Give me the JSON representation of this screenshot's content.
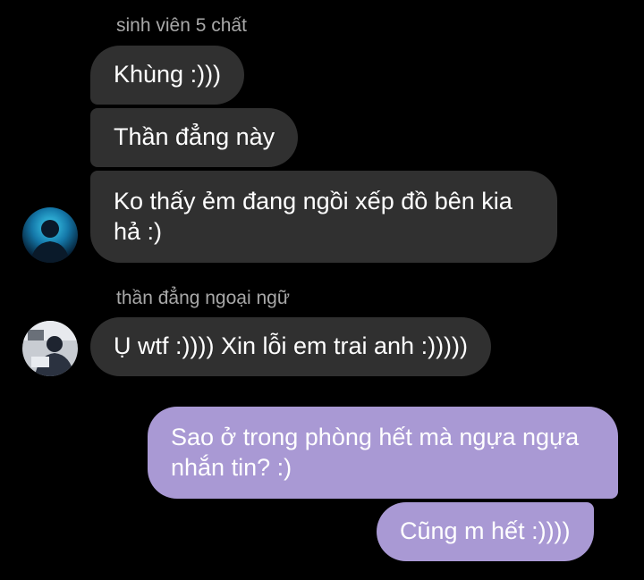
{
  "groups": [
    {
      "sender": "sinh viên 5 chất",
      "messages": [
        "Khùng :)))",
        "Thần đẳng này",
        "Ko thấy ẻm đang ngồi xếp đồ bên kia hả :)"
      ],
      "avatar_icon": "user-avatar-silhouette-blue"
    },
    {
      "sender": "thần đẳng ngoại ngữ",
      "messages": [
        "Ụ wtf :)))) Xin lỗi em trai anh :)))))"
      ],
      "avatar_icon": "user-avatar-photo"
    }
  ],
  "outgoing": [
    "Sao ở trong phòng hết mà ngựa ngựa nhắn tin? :)",
    "Cũng m hết :))))"
  ],
  "colors": {
    "background": "#000000",
    "incoming_bubble": "#303030",
    "outgoing_bubble": "#a999d4",
    "sender_label": "#a8a8a8",
    "text": "#ffffff"
  }
}
